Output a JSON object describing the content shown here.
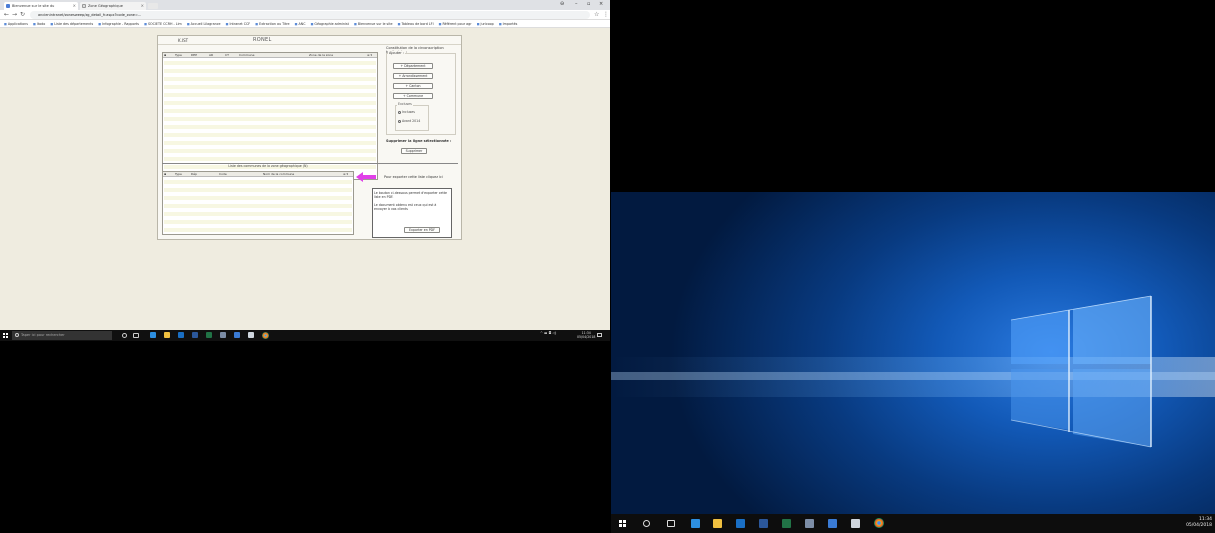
{
  "browser": {
    "tabs": [
      {
        "label": "Bienvenue sur le site du"
      },
      {
        "label": "Zone Géographique"
      }
    ],
    "url": "ancienintranet/zonesweep/zg_detail_fr.aspx?code_zone=...",
    "bookmarks": [
      "Applications",
      "Itodo",
      "Liste des départements",
      "Infographie - Rapports",
      "SOCIETE CCRH - Lim",
      "Accueil Lilagrance",
      "Intranet CCF",
      "Extraction au Titre",
      "ANC",
      "Géographie administ",
      "Bienvenue sur le site",
      "Tableau de bord LFI",
      "Référent pour agr",
      "juricoop",
      "Importés"
    ]
  },
  "app": {
    "tab_label": "K.IST",
    "title": "RONEL",
    "top_grid": {
      "headers": [
        "Type",
        "DEP",
        "AR",
        "CT",
        "Commune",
        "Zone de la zone"
      ]
    },
    "constitution_title": "Constitution de la circonscription territoriale :",
    "ajouter_label": "Ajouter :",
    "add_buttons": [
      "+ Département",
      "+ Arrondissement",
      "+ Canton",
      "+ Commune"
    ],
    "excluses_label": "Excluses",
    "radios": [
      {
        "label": "Incluses",
        "checked": true
      },
      {
        "label": "Avant 2014",
        "checked": false
      }
    ],
    "suppr_title": "Supprimer la ligne sélectionnée :",
    "suppr_button": "Supprimer",
    "bottom_grid": {
      "title": "Liste des communes de la zone géographique (N)",
      "headers": [
        "Type",
        "Dép",
        "Code",
        "Nom de la commune"
      ]
    },
    "export_hint": "Pour exporter cette liste cliquez ici",
    "export_text_1": "Le bouton ci-dessous permet d'exporter cette liste en PDF.",
    "export_text_2": "Le document obtenu est ceux qui est à envoyer à vos clients",
    "export_button": "Exporter en PDF"
  },
  "taskbar_left": {
    "search_placeholder": "Taper ici pour rechercher",
    "time": "11:34",
    "date": "05/04/2018"
  },
  "taskbar_right": {
    "time": "11:34",
    "date": "05/04/2018"
  },
  "colors": {
    "page_bg": "#efece0",
    "arrow": "#e040e8",
    "row_alt": "#f7f7e2",
    "wallpaper": "#1259b7"
  }
}
